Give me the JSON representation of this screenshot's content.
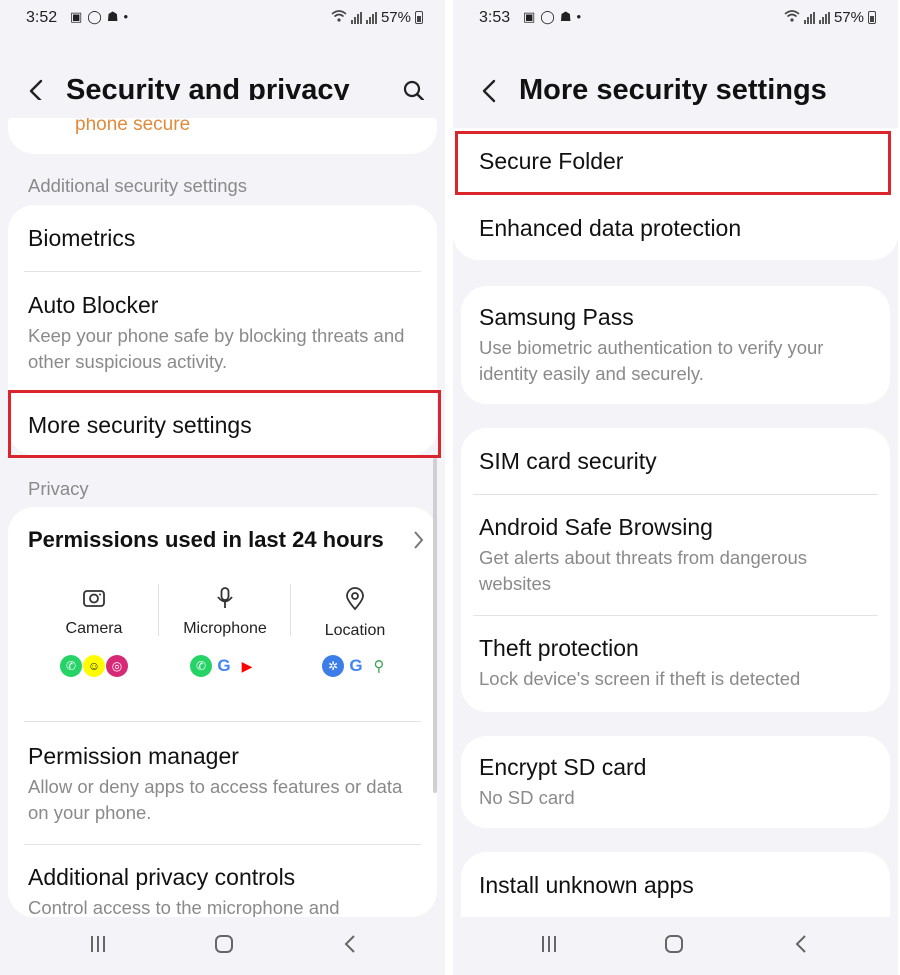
{
  "left": {
    "status": {
      "time": "3:52",
      "battery": "57%"
    },
    "title": "Security and privacy",
    "cut_off_text": "phone secure",
    "section_additional": "Additional security settings",
    "biometrics": "Biometrics",
    "auto_blocker": {
      "title": "Auto Blocker",
      "subtitle": "Keep your phone safe by blocking threats and other suspicious activity."
    },
    "more_security": "More security settings",
    "section_privacy": "Privacy",
    "permissions": {
      "title": "Permissions used in last 24 hours",
      "camera": "Camera",
      "microphone": "Microphone",
      "location": "Location"
    },
    "permission_manager": {
      "title": "Permission manager",
      "subtitle": "Allow or deny apps to access features or data on your phone."
    },
    "additional_privacy": {
      "title": "Additional privacy controls",
      "subtitle": "Control access to the microphone and"
    }
  },
  "right": {
    "status": {
      "time": "3:53",
      "battery": "57%"
    },
    "title": "More security settings",
    "secure_folder": "Secure Folder",
    "enhanced": "Enhanced data protection",
    "samsung_pass": {
      "title": "Samsung Pass",
      "subtitle": "Use biometric authentication to verify your identity easily and securely."
    },
    "sim": "SIM card security",
    "safe_browsing": {
      "title": "Android Safe Browsing",
      "subtitle": "Get alerts about threats from dangerous websites"
    },
    "theft": {
      "title": "Theft protection",
      "subtitle": "Lock device's screen if theft is detected"
    },
    "encrypt": {
      "title": "Encrypt SD card",
      "subtitle": "No SD card"
    },
    "unknown_apps": "Install unknown apps"
  },
  "colors": {
    "highlight": "#d9252b",
    "accent_orange": "#e08a3c",
    "background": "#f4f3f8"
  }
}
